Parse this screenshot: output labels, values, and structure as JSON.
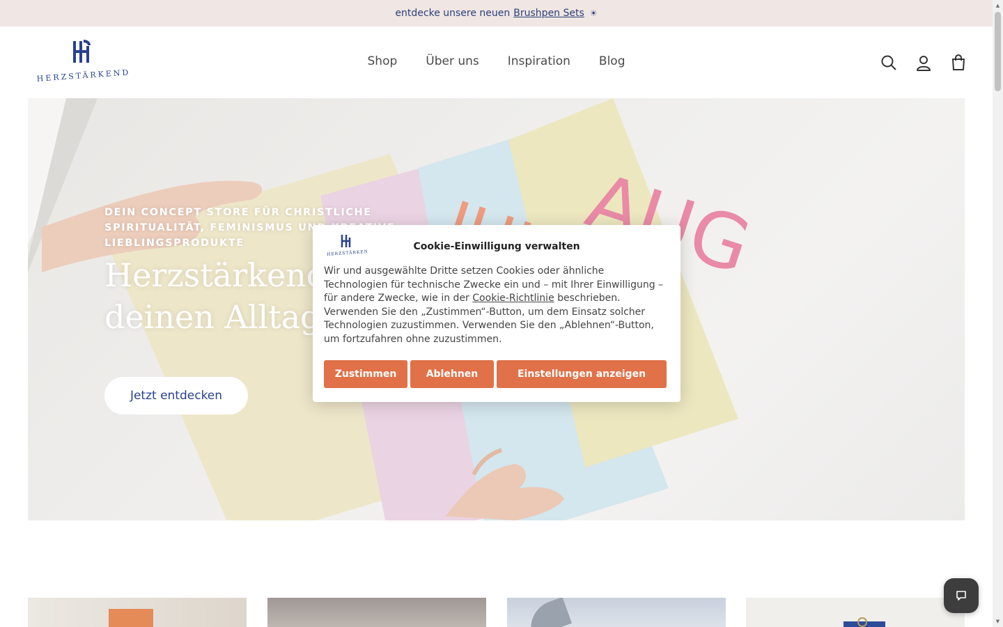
{
  "announcement": {
    "text": "entdecke unsere neuen",
    "link_label": "Brushpen Sets",
    "spark": "☀"
  },
  "header": {
    "logo_text": "HERZSTÄRKEND",
    "nav": [
      "Shop",
      "Über uns",
      "Inspiration",
      "Blog"
    ],
    "icons": [
      "search-icon",
      "account-icon",
      "cart-icon"
    ]
  },
  "hero": {
    "eyebrow": "DEIN CONCEPT STORE FÜR CHRISTLICHE SPIRITUALITÄT, FEMINISMUS UND KREATIVE LIEBLINGSPRODUKTE",
    "title": "Herzstärkend durch deinen Alltag",
    "cta": "Jetzt entdecken",
    "paper_text": [
      "AUG",
      "JUL"
    ]
  },
  "cookie": {
    "title": "Cookie-Einwilligung verwalten",
    "text_before": "Wir und ausgewählte Dritte setzen Cookies oder ähnliche Technologien für technische Zwecke ein und – mit Ihrer Einwilligung – für andere Zwecke, wie in der",
    "link": "Cookie-Richtlinie",
    "text_after": "beschrieben. Verwenden Sie den „Zustimmen“-Button, um dem Einsatz solcher Technologien zuzustimmen. Verwenden Sie den „Ablehnen“-Button, um fortzufahren ohne zuzustimmen.",
    "buttons": {
      "accept": "Zustimmen",
      "reject": "Ablehnen",
      "settings": "Einstellungen anzeigen"
    }
  },
  "colors": {
    "announcement_bg": "#f0e6e3",
    "brand_blue": "#27418f",
    "cookie_button": "#e07148",
    "chat_bg": "#3d3d3d"
  }
}
